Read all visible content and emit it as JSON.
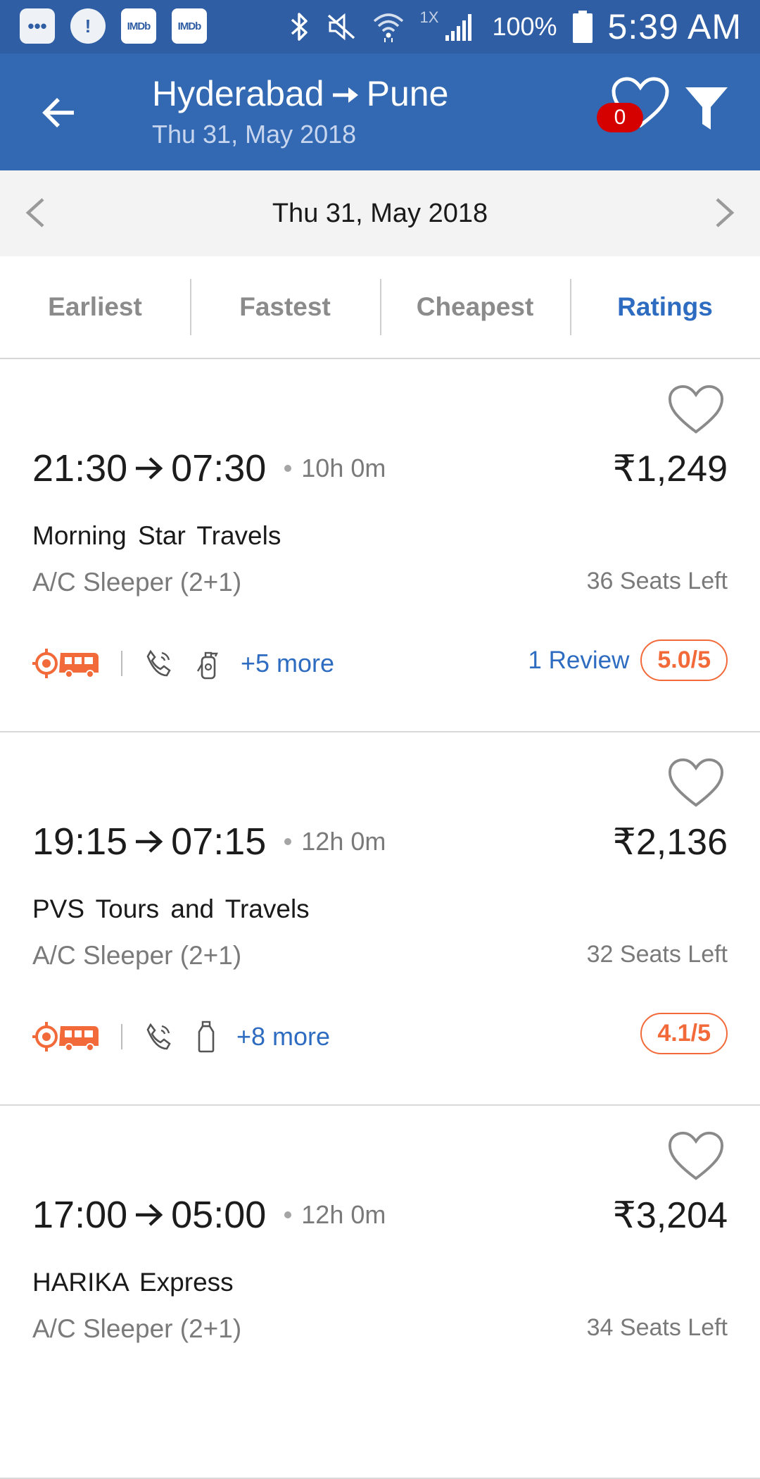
{
  "status_bar": {
    "icons": [
      "chat-notification-icon",
      "alert-icon",
      "imdb-icon",
      "imdb-icon",
      "bluetooth-icon",
      "mute-icon",
      "wifi-icon",
      "signal-icon",
      "battery-icon"
    ],
    "imdb_label": "IMDb",
    "network_label": "1X",
    "battery": "100%",
    "time": "5:39 AM"
  },
  "header": {
    "from": "Hyderabad",
    "to": "Pune",
    "date": "Thu 31, May 2018",
    "favorites_count": "0"
  },
  "date_nav": {
    "label": "Thu 31, May 2018"
  },
  "sort_tabs": [
    {
      "label": "Earliest",
      "active": false
    },
    {
      "label": "Fastest",
      "active": false
    },
    {
      "label": "Cheapest",
      "active": false
    },
    {
      "label": "Ratings",
      "active": true
    }
  ],
  "buses": [
    {
      "departure": "21:30",
      "arrival": "07:30",
      "duration": "10h 0m",
      "price": "₹1,249",
      "operator": "Morning  Star  Travels",
      "type": "A/C Sleeper (2+1)",
      "seats": "36 Seats Left",
      "amenities": [
        "live-tracking-bus-icon",
        "emergency-call-icon",
        "fire-extinguisher-icon"
      ],
      "more": "+5 more",
      "reviews": "1 Review",
      "rating": "5.0/5"
    },
    {
      "departure": "19:15",
      "arrival": "07:15",
      "duration": "12h 0m",
      "price": "₹2,136",
      "operator": "PVS Tours and Travels",
      "type": "A/C Sleeper (2+1)",
      "seats": "32 Seats Left",
      "amenities": [
        "live-tracking-bus-icon",
        "emergency-call-icon",
        "water-bottle-icon"
      ],
      "more": "+8 more",
      "reviews": "",
      "rating": "4.1/5"
    },
    {
      "departure": "17:00",
      "arrival": "05:00",
      "duration": "12h 0m",
      "price": "₹3,204",
      "operator": "HARIKA Express",
      "type": "A/C Sleeper (2+1)",
      "seats": "34 Seats Left"
    }
  ],
  "colors": {
    "status_bar": "#2f5ea4",
    "app_bar": "#3369b2",
    "accent_blue": "#2d6cc0",
    "rating_orange": "#f26a39",
    "badge_red": "#d50000"
  }
}
